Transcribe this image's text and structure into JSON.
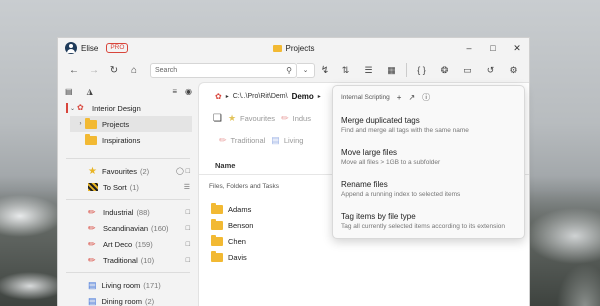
{
  "titlebar": {
    "user": "Elise",
    "badge": "PRO",
    "title": "Projects"
  },
  "toolbar": {
    "search_placeholder": "Search"
  },
  "left_panel": {
    "tree": [
      {
        "label": "Interior Design"
      },
      {
        "label": "Projects"
      },
      {
        "label": "Inspirations"
      }
    ],
    "favourites": {
      "label": "Favourites",
      "count": "(2)"
    },
    "to_sort": {
      "label": "To Sort",
      "count": "(1)"
    },
    "tags": [
      {
        "label": "Industrial",
        "count": "(88)"
      },
      {
        "label": "Scandinavian",
        "count": "(160)"
      },
      {
        "label": "Art Deco",
        "count": "(159)"
      },
      {
        "label": "Traditional",
        "count": "(10)"
      }
    ],
    "rooms": [
      {
        "label": "Living room",
        "count": "(171)"
      },
      {
        "label": "Dining room",
        "count": "(2)"
      }
    ]
  },
  "main": {
    "breadcrumb_path": "C:\\..\\Pro\\Rit\\Dem\\",
    "breadcrumb_current": "Demo",
    "filters": [
      "Favourites",
      "Indus",
      "Traditional",
      "Living"
    ],
    "column_name": "Name",
    "group_header": "Files, Folders and Tasks",
    "files": [
      "Adams",
      "Benson",
      "Chen",
      "Davis"
    ]
  },
  "popup": {
    "title": "Internal Scripting",
    "items": [
      {
        "title": "Merge duplicated tags",
        "desc": "Find and merge all tags with the same name"
      },
      {
        "title": "Move large files",
        "desc": "Move all files > 1GB to a subfolder"
      },
      {
        "title": "Rename files",
        "desc": "Append a running index to selected items"
      },
      {
        "title": "Tag items by file type",
        "desc": "Tag all currently selected items according to its extension"
      }
    ]
  },
  "colors": {
    "accent": "#d8453b",
    "folder": "#f2b933"
  }
}
